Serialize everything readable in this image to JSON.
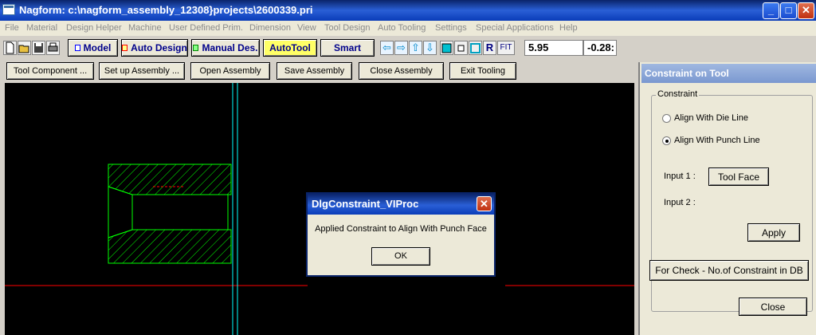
{
  "window": {
    "title": "Nagform: c:\\nagform_assembly_12308}projects\\2600339.pri",
    "minimize": "_",
    "maximize": "□",
    "close": "✕"
  },
  "menu": [
    "File",
    "Material",
    "Design Helper",
    "Machine",
    "User Defined Prim.",
    "Dimension",
    "View",
    "Tool Design",
    "Auto Tooling",
    "Settings",
    "Special Applications",
    "Help"
  ],
  "toolbar": {
    "model": "Model",
    "auto_design": "Auto Design",
    "manual_des": "Manual Des.",
    "autotool": "AutoTool",
    "smart": "Smart",
    "arrows": [
      "⇦",
      "⇨",
      "⇧",
      "⇩"
    ],
    "r": "R",
    "fit": "FIT",
    "coord_x": "5.95",
    "coord_y": "-0.28:"
  },
  "commands": [
    "Tool Component ...",
    "Set up Assembly ...",
    "Open Assembly",
    "Save Assembly",
    "Close Assembly",
    "Exit Tooling"
  ],
  "panel": {
    "title": "Constraint on Tool",
    "group_label": "Constraint",
    "radio_die": "Align With Die Line",
    "radio_punch": "Align With Punch Line",
    "selected": "punch",
    "input1_label": "Input 1 :",
    "tool_face": "Tool Face",
    "input2_label": "Input 2 :",
    "apply": "Apply",
    "check": "For Check - No.of Constraint in DB",
    "close": "Close"
  },
  "dialog": {
    "title": "DlgConstraint_VIProc",
    "message": "Applied Constraint to Align With Punch Face",
    "ok": "OK",
    "close": "✕"
  },
  "colors": {
    "geometry": "#00ff00",
    "axis_red": "#ff0000",
    "axis_cyan": "#00ffff",
    "hatch_label": "#ff0000"
  }
}
